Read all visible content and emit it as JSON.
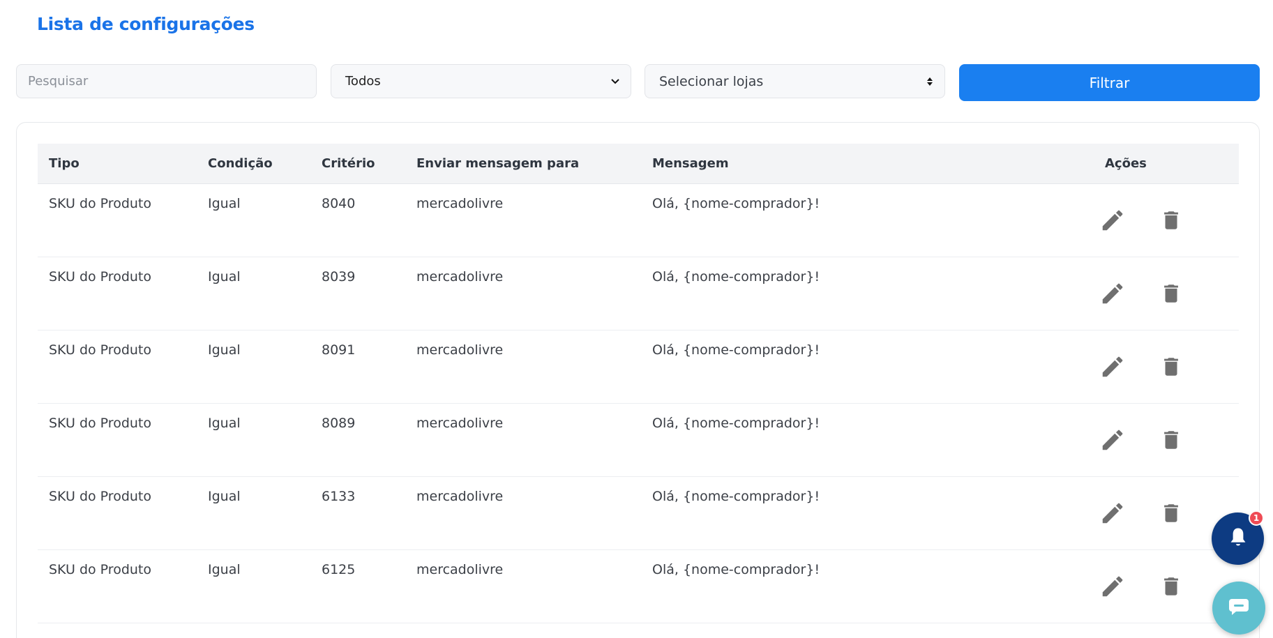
{
  "page": {
    "title": "Lista de configurações"
  },
  "filters": {
    "search_placeholder": "Pesquisar",
    "type_select_value": "Todos",
    "stores_select_value": "Selecionar lojas",
    "filter_button_label": "Filtrar"
  },
  "table": {
    "headers": {
      "tipo": "Tipo",
      "condicao": "Condição",
      "criterio": "Critério",
      "enviar": "Enviar mensagem para",
      "mensagem": "Mensagem",
      "acoes": "Ações"
    },
    "rows": [
      {
        "tipo": "SKU do Produto",
        "condicao": "Igual",
        "criterio": "8040",
        "enviar": "mercadolivre",
        "mensagem": "Olá, {nome-comprador}!"
      },
      {
        "tipo": "SKU do Produto",
        "condicao": "Igual",
        "criterio": "8039",
        "enviar": "mercadolivre",
        "mensagem": "Olá, {nome-comprador}!"
      },
      {
        "tipo": "SKU do Produto",
        "condicao": "Igual",
        "criterio": "8091",
        "enviar": "mercadolivre",
        "mensagem": "Olá, {nome-comprador}!"
      },
      {
        "tipo": "SKU do Produto",
        "condicao": "Igual",
        "criterio": "8089",
        "enviar": "mercadolivre",
        "mensagem": "Olá, {nome-comprador}!"
      },
      {
        "tipo": "SKU do Produto",
        "condicao": "Igual",
        "criterio": "6133",
        "enviar": "mercadolivre",
        "mensagem": "Olá, {nome-comprador}!"
      },
      {
        "tipo": "SKU do Produto",
        "condicao": "Igual",
        "criterio": "6125",
        "enviar": "mercadolivre",
        "mensagem": "Olá, {nome-comprador}!"
      }
    ],
    "row_icons": {
      "edit": "pencil-icon",
      "delete": "trash-icon"
    }
  },
  "notifications": {
    "badge_count": "1",
    "icon": "bell-icon"
  },
  "chat": {
    "icon": "chat-icon"
  },
  "colors": {
    "accent": "#1a7ff0",
    "title": "#1a73e8",
    "notif_fab": "#0d3b82",
    "chat_fab": "#5fc0cf",
    "badge": "#ef4b55",
    "icon_gray": "#6f6f6f"
  }
}
